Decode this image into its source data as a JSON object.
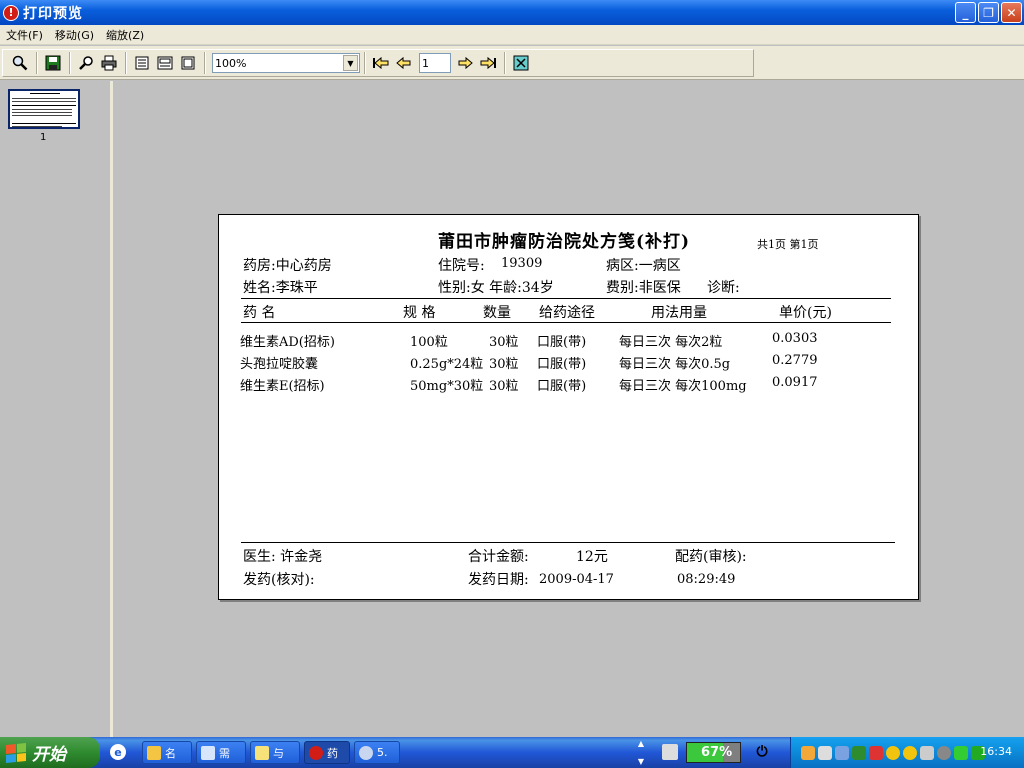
{
  "window": {
    "title": "打印预览",
    "minimize_label": "_",
    "restore_label": "❐",
    "close_label": "✕"
  },
  "menu": {
    "items": [
      "文件(F)",
      "移动(G)",
      "缩放(Z)"
    ]
  },
  "toolbar": {
    "zoom_value": "100%",
    "page_number": "1",
    "icons": [
      "zoom-icon",
      "save-icon",
      "find-icon",
      "print-icon",
      "one-page-icon",
      "two-page-icon",
      "multi-page-icon",
      "first-page-icon",
      "prev-page-icon",
      "next-page-icon",
      "last-page-icon",
      "exit-icon"
    ]
  },
  "thumbnail": {
    "page_label": "1"
  },
  "document": {
    "title": "莆田市肿瘤防治院处方笺(补打)",
    "page_info": "共1页 第1页",
    "header": {
      "pharmacy": "药房:中心药房",
      "inpatient_no_label": "住院号:",
      "inpatient_no": "19309",
      "ward": "病区:一病区",
      "name": "姓名:李珠平",
      "gender_age": "性别:女 年龄:34岁",
      "fee_type": "费别:非医保",
      "diagnosis": "诊断:"
    },
    "columns": [
      "药    名",
      "规  格",
      "数量",
      "给药途径",
      "用法用量",
      "单价(元)"
    ],
    "rows": [
      [
        "维生素AD(招标)",
        "100粒",
        "30粒",
        "口服(带)",
        "每日三次  每次2粒",
        "0.0303"
      ],
      [
        "头孢拉啶胶囊",
        "0.25g*24粒",
        "30粒",
        "口服(带)",
        "每日三次  每次0.5g",
        "0.2779"
      ],
      [
        "维生素E(招标)",
        "50mg*30粒",
        "30粒",
        "口服(带)",
        "每日三次  每次100mg",
        "0.0917"
      ]
    ],
    "footer": {
      "doctor": "医生: 许金尧",
      "total_label": "合计金额:",
      "total_value": "12元",
      "dispense_check": "配药(审核):",
      "dispense_verify": "发药(核对):",
      "dispense_date_label": "发药日期:",
      "dispense_date": "2009-04-17",
      "dispense_time": "08:29:49"
    }
  },
  "taskbar": {
    "start_label": "开始",
    "tasks": [
      "名",
      "需",
      "与",
      "药",
      "5."
    ],
    "battery_percent": 67,
    "battery_label": "67%",
    "clock": "16:34"
  }
}
